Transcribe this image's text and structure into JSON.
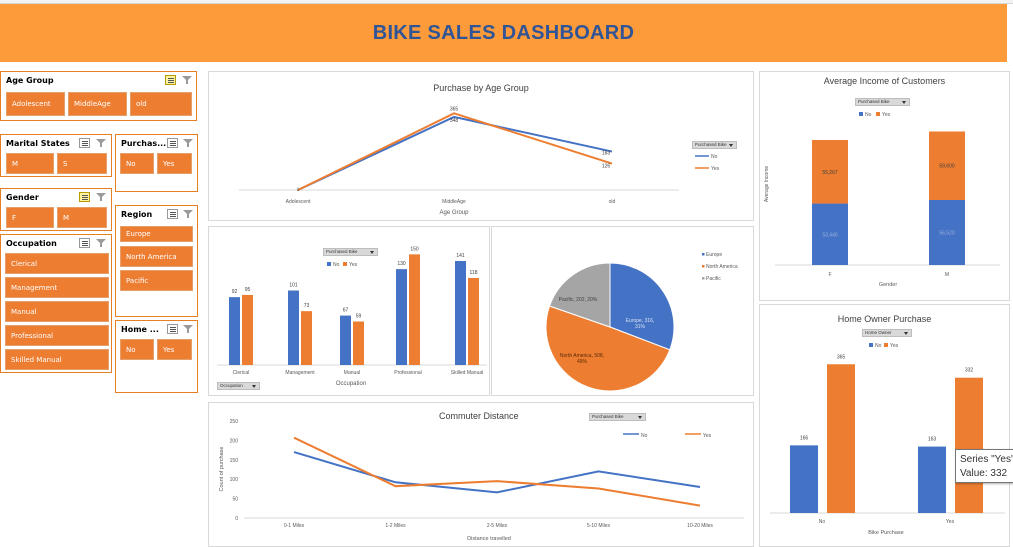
{
  "title": "BIKE SALES DASHBOARD",
  "colors": {
    "no": "#4472c4",
    "yes": "#ed7d31",
    "banner": "#fd9a3a",
    "title_text": "#2f5597",
    "slicer": "#ed7d31"
  },
  "slicers": {
    "age_group": {
      "header": "Age Group",
      "items": [
        "Adolescent",
        "MiddleAge",
        "old"
      ]
    },
    "marital": {
      "header": "Marital States",
      "items": [
        "M",
        "S"
      ]
    },
    "purchased": {
      "header": "Purchas...",
      "items": [
        "No",
        "Yes"
      ]
    },
    "gender": {
      "header": "Gender",
      "items": [
        "F",
        "M"
      ]
    },
    "region": {
      "header": "Region",
      "items": [
        "Europe",
        "North America",
        "Pacific"
      ]
    },
    "occupation": {
      "header": "Occupation",
      "items": [
        "Clerical",
        "Management",
        "Manual",
        "Professional",
        "Skilled Manual"
      ]
    },
    "home": {
      "header": "Home ...",
      "items": [
        "No",
        "Yes"
      ]
    }
  },
  "filters": {
    "purchased_bike": "Purchased Bike",
    "occupation": "Occupation",
    "home_owner": "Home Owner"
  },
  "legend": {
    "no": "No",
    "yes": "Yes"
  },
  "tooltip": {
    "line1": "Series \"Yes\"",
    "line2": "Value: 332"
  },
  "chart_data": [
    {
      "id": "age",
      "type": "line",
      "title": "Purchase by Age Group",
      "xlabel": "Age Group",
      "categories": [
        "Adolescent",
        "MiddleAge",
        "old"
      ],
      "series": [
        {
          "name": "No",
          "values": [
            0,
            348,
            183
          ],
          "labels": [
            "",
            "348",
            "183"
          ]
        },
        {
          "name": "Yes",
          "values": [
            0,
            365,
            126
          ],
          "labels": [
            "",
            "365",
            "126"
          ]
        }
      ],
      "ylim": [
        0,
        400
      ]
    },
    {
      "id": "income",
      "type": "bar",
      "stacked": true,
      "title": "Average Income of Customers",
      "xlabel": "Gender",
      "ylabel": "Average Income",
      "categories": [
        "F",
        "M"
      ],
      "series": [
        {
          "name": "No",
          "values": [
            53440,
            56520
          ],
          "labels": [
            "53,440",
            "56,520"
          ]
        },
        {
          "name": "Yes",
          "values": [
            55267,
            59600
          ],
          "labels": [
            "55,267",
            "59,600"
          ]
        }
      ]
    },
    {
      "id": "occupation",
      "type": "bar",
      "title": "",
      "xlabel": "Occupation",
      "categories": [
        "Clerical",
        "Management",
        "Manual",
        "Professional",
        "Skilled Manual"
      ],
      "series": [
        {
          "name": "No",
          "values": [
            92,
            101,
            67,
            130,
            141
          ]
        },
        {
          "name": "Yes",
          "values": [
            95,
            73,
            59,
            150,
            118
          ]
        }
      ],
      "ylim": [
        0,
        160
      ]
    },
    {
      "id": "region",
      "type": "pie",
      "title": "",
      "categories": [
        "Europe",
        "North America",
        "Pacific"
      ],
      "values": [
        316,
        508,
        202
      ],
      "percent": [
        31,
        49,
        20
      ],
      "labels": [
        "Europe, 316, 31%",
        "North America, 508, 49%",
        "Pacific, 202, 20%"
      ],
      "colors": [
        "#4472c4",
        "#ed7d31",
        "#a5a5a5"
      ]
    },
    {
      "id": "commute",
      "type": "line",
      "title": "Commuter Distance",
      "xlabel": "Distance travelled",
      "ylabel": "Count of purchase",
      "categories": [
        "0-1 Miles",
        "1-2 Miles",
        "2-5 Miles",
        "5-10 Miles",
        "10-20 Miles"
      ],
      "series": [
        {
          "name": "No",
          "values": [
            170,
            92,
            66,
            120,
            80
          ]
        },
        {
          "name": "Yes",
          "values": [
            207,
            82,
            95,
            76,
            32
          ]
        }
      ],
      "ylim": [
        0,
        250
      ],
      "yticks": [
        "0",
        "50",
        "100",
        "150",
        "200",
        "250"
      ]
    },
    {
      "id": "home",
      "type": "bar",
      "title": "Home Owner Purchase",
      "xlabel": "Bike Purchase",
      "categories": [
        "No",
        "Yes"
      ],
      "series": [
        {
          "name": "No",
          "values": [
            166,
            163
          ]
        },
        {
          "name": "Yes",
          "values": [
            365,
            332
          ]
        }
      ],
      "ylim": [
        0,
        400
      ]
    }
  ]
}
